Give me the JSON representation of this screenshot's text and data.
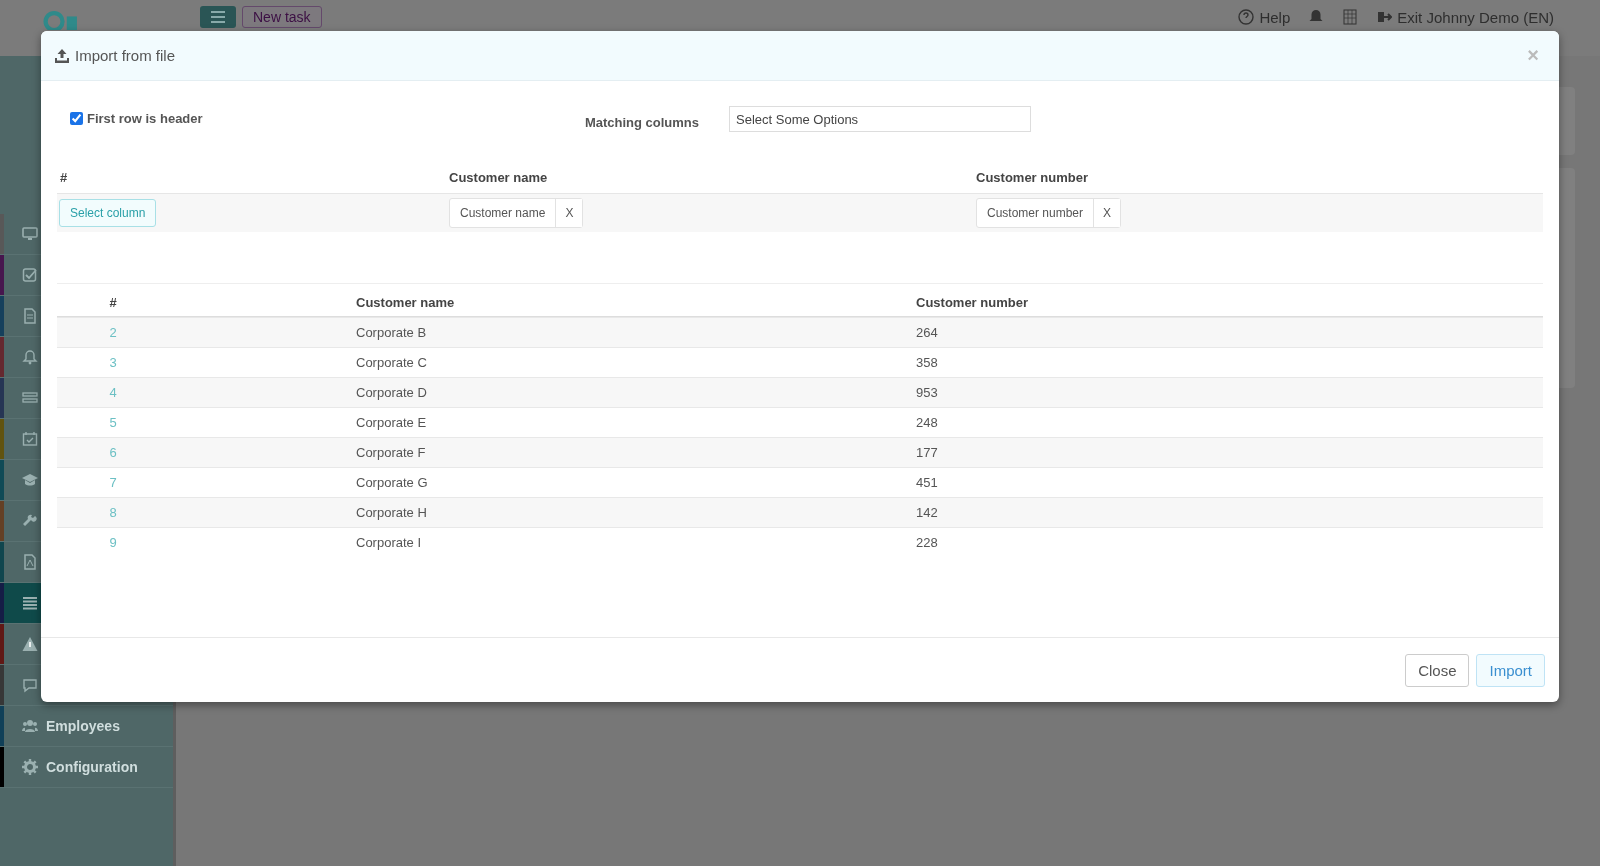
{
  "topbar": {
    "new_task": "New task",
    "help": "Help",
    "exit": "Exit Johnny Demo (EN)"
  },
  "sidebar": {
    "items": [
      {
        "color": "#585858",
        "selected": false
      },
      {
        "color": "#47164e",
        "selected": false
      },
      {
        "color": "#16405c",
        "selected": false
      },
      {
        "color": "#65282f",
        "selected": false
      },
      {
        "color": "#263554",
        "selected": false
      },
      {
        "color": "#61530f",
        "selected": false
      },
      {
        "color": "#104a56",
        "selected": false
      },
      {
        "color": "#644025",
        "selected": false
      },
      {
        "color": "#10464e",
        "selected": false
      },
      {
        "color": "#151d46",
        "selected": true
      },
      {
        "color": "#601815",
        "selected": false
      },
      {
        "color": "#373737",
        "selected": false
      },
      {
        "color": "#104058",
        "selected": false,
        "label": "Employees"
      },
      {
        "color": "#000000",
        "selected": false,
        "label": "Configuration"
      }
    ]
  },
  "modal": {
    "title": "Import from file",
    "close": "×",
    "first_row_header": {
      "label": "First row is header",
      "checked": true
    },
    "matching": {
      "label": "Matching columns",
      "placeholder": "Select Some Options"
    },
    "mapping": {
      "columns": [
        "#",
        "Customer name",
        "Customer number"
      ],
      "select_button": "Select column",
      "tags": [
        {
          "label": "Customer name",
          "remove": "X"
        },
        {
          "label": "Customer number",
          "remove": "X"
        }
      ]
    },
    "table": {
      "columns": [
        "#",
        "Customer name",
        "Customer number"
      ],
      "rows": [
        [
          "2",
          "Corporate B",
          "264"
        ],
        [
          "3",
          "Corporate C",
          "358"
        ],
        [
          "4",
          "Corporate D",
          "953"
        ],
        [
          "5",
          "Corporate E",
          "248"
        ],
        [
          "6",
          "Corporate F",
          "177"
        ],
        [
          "7",
          "Corporate G",
          "451"
        ],
        [
          "8",
          "Corporate H",
          "142"
        ],
        [
          "9",
          "Corporate I",
          "228"
        ]
      ]
    },
    "buttons": [
      "Close",
      "Import"
    ]
  }
}
